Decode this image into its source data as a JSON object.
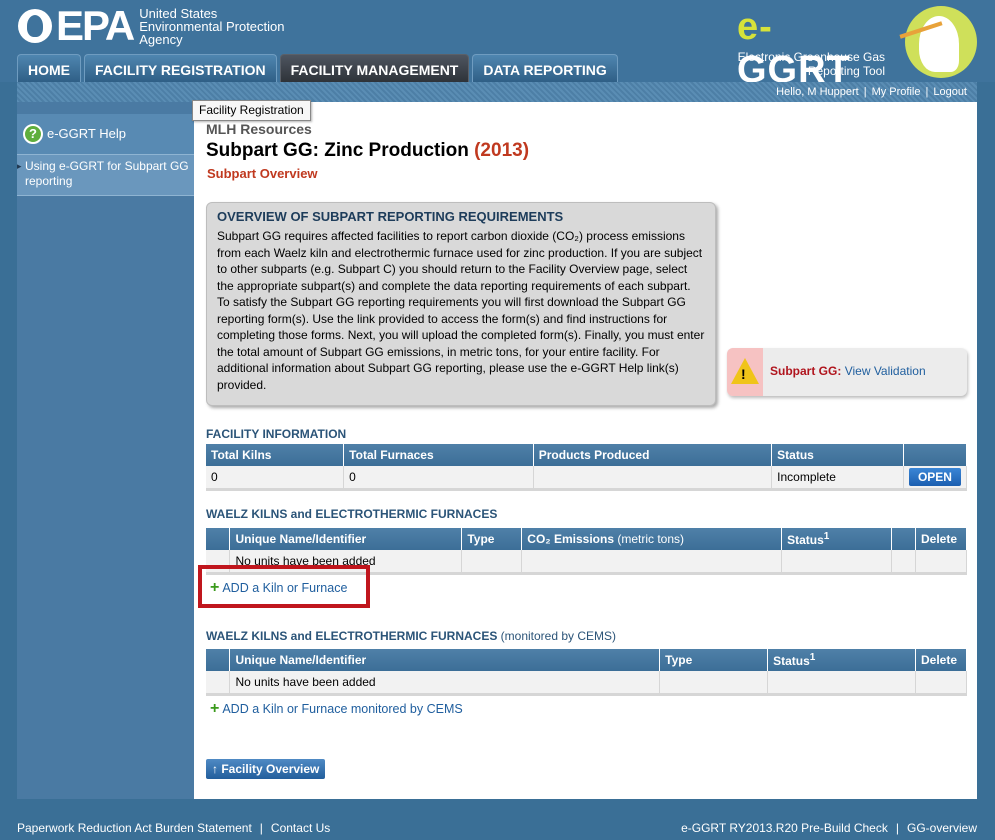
{
  "header": {
    "agency_lines": [
      "United States",
      "Environmental Protection",
      "Agency"
    ],
    "epa_word": "EPA",
    "app_logo_prefix": "e-",
    "app_logo_name": "GGRT",
    "app_subtitle_1": "Electronic Greenhouse Gas",
    "app_subtitle_2": "Reporting Tool"
  },
  "nav": {
    "tabs": [
      {
        "label": "HOME"
      },
      {
        "label": "FACILITY REGISTRATION"
      },
      {
        "label": "FACILITY MANAGEMENT"
      },
      {
        "label": "DATA REPORTING"
      }
    ]
  },
  "userbar": {
    "greeting": "Hello, M Huppert",
    "profile": "My Profile",
    "logout": "Logout",
    "separator": "|"
  },
  "tooltip": "Facility Registration",
  "sidebar": {
    "help_title": "e-GGRT Help",
    "help_icon": "?",
    "help_link": "Using e-GGRT for Subpart GG reporting"
  },
  "main": {
    "org": "MLH Resources",
    "title": "Subpart GG: Zinc Production",
    "year": "(2013)",
    "subtitle": "Subpart Overview",
    "overview_heading": "OVERVIEW OF SUBPART REPORTING REQUIREMENTS",
    "overview_text": "Subpart GG requires affected facilities to report carbon dioxide (CO₂) process emissions from each Waelz kiln and electrothermic furnace used for zinc production. If you are subject to other subparts (e.g. Subpart C) you should return to the Facility Overview page, select the appropriate subpart(s) and complete the data reporting requirements of each subpart. To satisfy the Subpart GG reporting requirements you will first download the Subpart GG reporting form(s). Use the link provided to access the form(s) and find instructions for completing those forms. Next, you will upload the completed form(s). Finally, you must enter the total amount of Subpart GG emissions, in metric tons, for your entire facility. For additional information about Subpart GG reporting, please use the e-GGRT Help link(s) provided.",
    "validation_label": "Subpart GG:",
    "validation_link": "View Validation",
    "warn_glyph": "!",
    "facility_info_title": "FACILITY INFORMATION",
    "facility_table": {
      "headers": [
        "Total Kilns",
        "Total Furnaces",
        "Products Produced",
        "Status",
        ""
      ],
      "row": [
        "0",
        "0",
        "",
        "Incomplete"
      ],
      "open_label": "OPEN"
    },
    "kilns_title": "WAELZ KILNS and ELECTROTHERMIC FURNACES",
    "kilns_table": {
      "headers": [
        "",
        "Unique Name/Identifier",
        "Type",
        "CO₂ Emissions",
        "(metric tons)",
        "Status",
        "1",
        "",
        "Delete"
      ],
      "empty": "No units have been added"
    },
    "add_kiln": "ADD a Kiln or Furnace",
    "cems_title": "WAELZ KILNS and ELECTROTHERMIC FURNACES",
    "cems_title_suffix": "(monitored by CEMS)",
    "cems_table": {
      "headers": [
        "",
        "Unique Name/Identifier",
        "Type",
        "Status",
        "1",
        "Delete"
      ],
      "empty": "No units have been added"
    },
    "add_cems": "ADD a Kiln or Furnace monitored by CEMS",
    "facility_overview_btn": "Facility Overview",
    "btn_arrow": "↑"
  },
  "footer": {
    "paperwork": "Paperwork Reduction Act Burden Statement",
    "contact": "Contact Us",
    "build": "e-GGRT RY2013.R20 Pre-Build Check",
    "page_id": "GG-overview",
    "separator": "|"
  },
  "colors": {
    "header_bg": "#3f739c",
    "accent_red": "#c0391f",
    "link_blue": "#1f5e9e",
    "table_header": "#4f80a8"
  }
}
